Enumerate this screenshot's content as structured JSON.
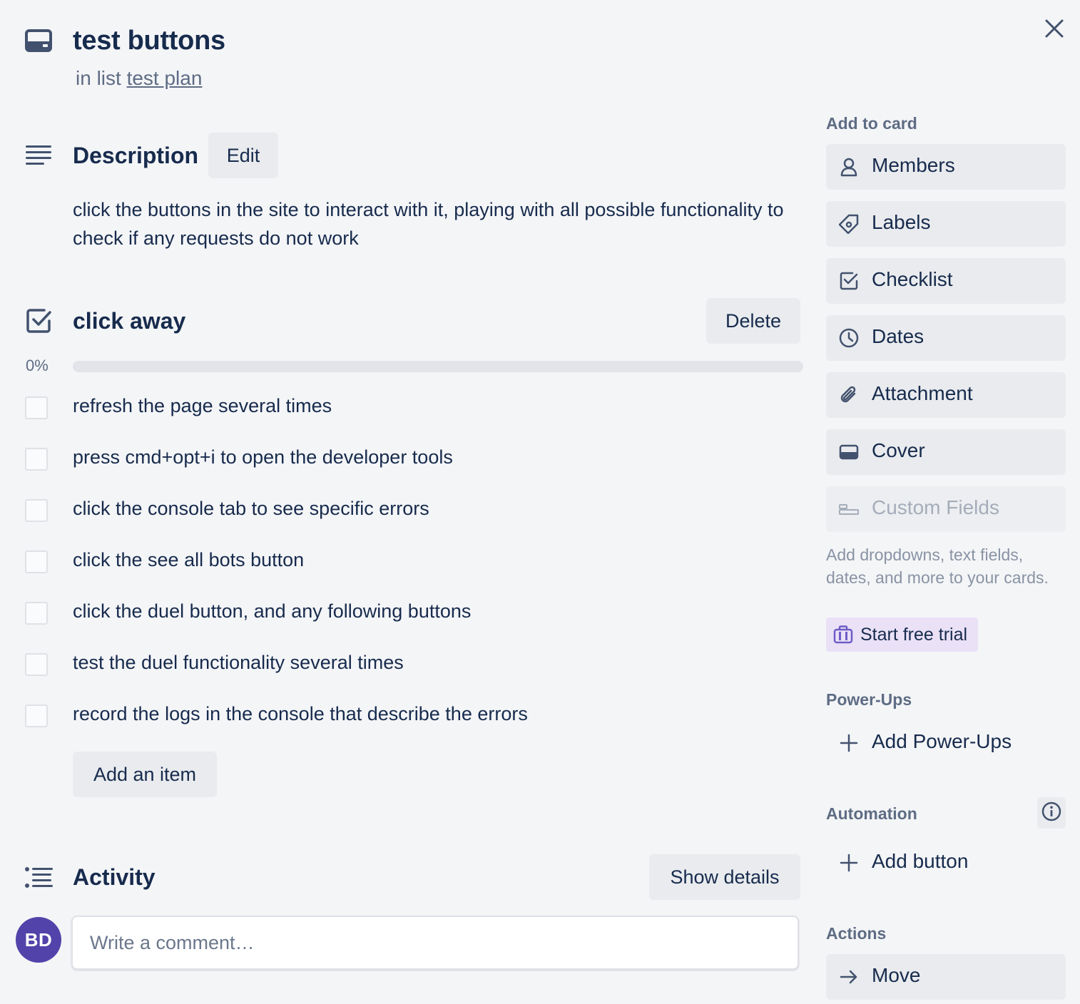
{
  "card": {
    "title": "test buttons",
    "in_list_prefix": "in list",
    "list_name": "test plan"
  },
  "description": {
    "heading": "Description",
    "edit_label": "Edit",
    "text": "click the buttons in the site to interact with it, playing with all possible functionality to check if any requests do not work"
  },
  "checklist": {
    "title": "click away",
    "delete_label": "Delete",
    "progress_label": "0%",
    "progress_fraction": 0,
    "items": [
      {
        "text": "refresh the page several times",
        "checked": false
      },
      {
        "text": "press cmd+opt+i to open the developer tools",
        "checked": false
      },
      {
        "text": "click the console tab to see specific errors",
        "checked": false
      },
      {
        "text": "click the see all bots button",
        "checked": false
      },
      {
        "text": "click the duel button, and any following buttons",
        "checked": false
      },
      {
        "text": "test the duel functionality several times",
        "checked": false
      },
      {
        "text": "record the logs in the console that describe the errors",
        "checked": false
      }
    ],
    "add_item_label": "Add an item"
  },
  "activity": {
    "heading": "Activity",
    "show_details_label": "Show details",
    "avatar_initials": "BD",
    "comment_placeholder": "Write a comment…"
  },
  "sidebar": {
    "add_to_card": {
      "heading": "Add to card",
      "buttons": [
        {
          "label": "Members",
          "icon": "person-icon"
        },
        {
          "label": "Labels",
          "icon": "tag-icon"
        },
        {
          "label": "Checklist",
          "icon": "checklist-icon"
        },
        {
          "label": "Dates",
          "icon": "clock-icon"
        },
        {
          "label": "Attachment",
          "icon": "paperclip-icon"
        },
        {
          "label": "Cover",
          "icon": "cover-icon"
        },
        {
          "label": "Custom Fields",
          "icon": "custom-fields-icon",
          "disabled": true
        }
      ],
      "upsell_text": "Add dropdowns, text fields, dates, and more to your cards.",
      "trial_label": "Start free trial"
    },
    "power_ups": {
      "heading": "Power-Ups",
      "add_label": "Add Power-Ups"
    },
    "automation": {
      "heading": "Automation",
      "add_label": "Add button"
    },
    "actions": {
      "heading": "Actions",
      "move_label": "Move"
    }
  },
  "colors": {
    "background": "#f4f5f7",
    "text": "#172b4d",
    "muted": "#5e6c84",
    "button_bg": "#e9ebee",
    "avatar_bg": "#5243aa",
    "trial_bg": "#eae1f7",
    "trial_icon": "#6e5dc6"
  }
}
